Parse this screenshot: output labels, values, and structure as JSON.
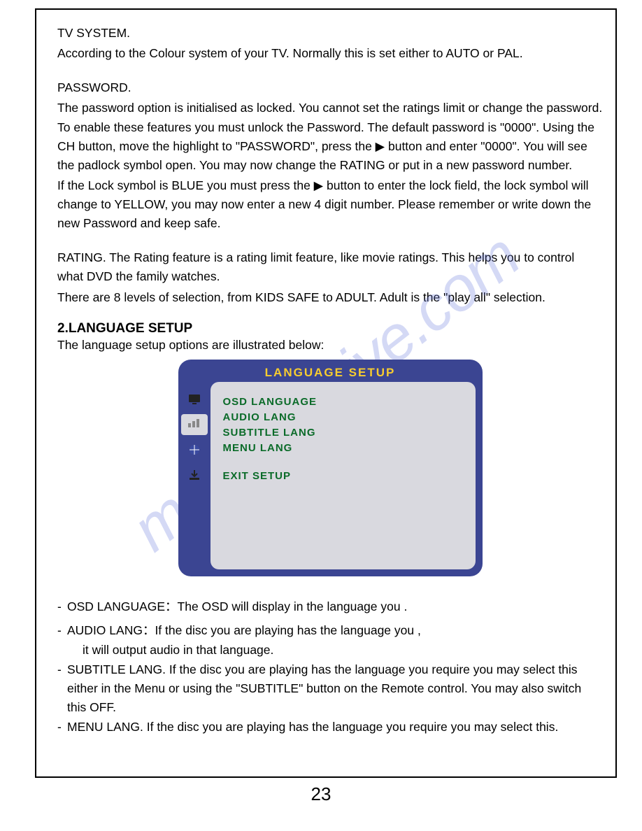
{
  "sections": {
    "tv_system": {
      "title": "TV SYSTEM.",
      "body": "According to the Colour system of your TV.  Normally this is set either to AUTO or PAL."
    },
    "password": {
      "title": "PASSWORD.",
      "p1": "The password option is initialised as locked.   You cannot set the ratings limit or change the password.    To enable these features you must unlock the Password.  The default password is \"0000\".  Using the CH  button, move the highlight to \"PASSWORD\", press the ▶  button and enter \"0000\".  You will see the padlock symbol open.   You may now change the RATING or put in a new password number.",
      "p2": "If the Lock symbol is BLUE you must press the ▶ button to enter the lock field, the lock symbol will change to YELLOW, you may now enter a new 4 digit number.   Please remember or write down the new Password and keep safe."
    },
    "rating": {
      "p1": "RATING.  The Rating feature is a rating limit feature, like movie ratings.   This helps you  to control what DVD the family watches.",
      "p2": "There are 8 levels of selection, from KIDS SAFE to ADULT.  Adult is the \"play all\" selection."
    }
  },
  "language_setup": {
    "heading": "2.LANGUAGE SETUP",
    "subtitle": "The language setup options are illustrated below:",
    "menu": {
      "title": "LANGUAGE SETUP",
      "items": [
        "OSD LANGUAGE",
        "AUDIO LANG",
        "SUBTITLE LANG",
        "MENU LANG"
      ],
      "exit": "EXIT SETUP",
      "icons": [
        "tv-icon",
        "av-icon",
        "globe-icon",
        "download-icon"
      ]
    },
    "bullets": [
      "OSD  LANGUAGE：The  OSD  will  display  in  the  language  you              .",
      "AUDIO LANG：If  the  disc  you  are  playing  has  the  language  you            ,",
      "   it  will output audio in that language.",
      "SUBTITLE LANG. If the disc you are playing has the language you require you may select this either in the Menu or using the \"SUBTITLE\" button on the Remote control. You may also switch this OFF.",
      "MENU LANG.  If the disc you are playing has the language you require you may select this."
    ]
  },
  "page_number": "23",
  "watermark": "manualshive.com"
}
